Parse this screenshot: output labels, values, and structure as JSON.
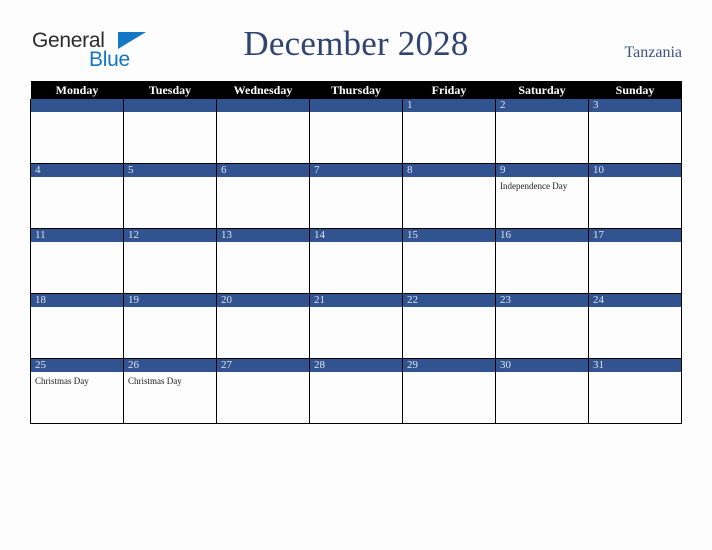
{
  "brand": {
    "name_part1": "General",
    "name_part2": "Blue",
    "triangle_color": "#1277c4",
    "text_color": "#2b2b2b"
  },
  "header": {
    "title": "December 2028",
    "country": "Tanzania",
    "title_color": "#2f4471",
    "country_color": "#3c5280"
  },
  "calendar": {
    "month": "December",
    "year": "2028",
    "header_bg": "#000000",
    "header_fg": "#ffffff",
    "daybar_bg": "#31538f",
    "daybar_fg": "#dfe4ef",
    "weekdays": [
      "Monday",
      "Tuesday",
      "Wednesday",
      "Thursday",
      "Friday",
      "Saturday",
      "Sunday"
    ],
    "weeks": [
      [
        {
          "day": "",
          "events": []
        },
        {
          "day": "",
          "events": []
        },
        {
          "day": "",
          "events": []
        },
        {
          "day": "",
          "events": []
        },
        {
          "day": "1",
          "events": []
        },
        {
          "day": "2",
          "events": []
        },
        {
          "day": "3",
          "events": []
        }
      ],
      [
        {
          "day": "4",
          "events": []
        },
        {
          "day": "5",
          "events": []
        },
        {
          "day": "6",
          "events": []
        },
        {
          "day": "7",
          "events": []
        },
        {
          "day": "8",
          "events": []
        },
        {
          "day": "9",
          "events": [
            "Independence Day"
          ]
        },
        {
          "day": "10",
          "events": []
        }
      ],
      [
        {
          "day": "11",
          "events": []
        },
        {
          "day": "12",
          "events": []
        },
        {
          "day": "13",
          "events": []
        },
        {
          "day": "14",
          "events": []
        },
        {
          "day": "15",
          "events": []
        },
        {
          "day": "16",
          "events": []
        },
        {
          "day": "17",
          "events": []
        }
      ],
      [
        {
          "day": "18",
          "events": []
        },
        {
          "day": "19",
          "events": []
        },
        {
          "day": "20",
          "events": []
        },
        {
          "day": "21",
          "events": []
        },
        {
          "day": "22",
          "events": []
        },
        {
          "day": "23",
          "events": []
        },
        {
          "day": "24",
          "events": []
        }
      ],
      [
        {
          "day": "25",
          "events": [
            "Christmas Day"
          ]
        },
        {
          "day": "26",
          "events": [
            "Christmas Day"
          ]
        },
        {
          "day": "27",
          "events": []
        },
        {
          "day": "28",
          "events": []
        },
        {
          "day": "29",
          "events": []
        },
        {
          "day": "30",
          "events": []
        },
        {
          "day": "31",
          "events": []
        }
      ]
    ]
  }
}
